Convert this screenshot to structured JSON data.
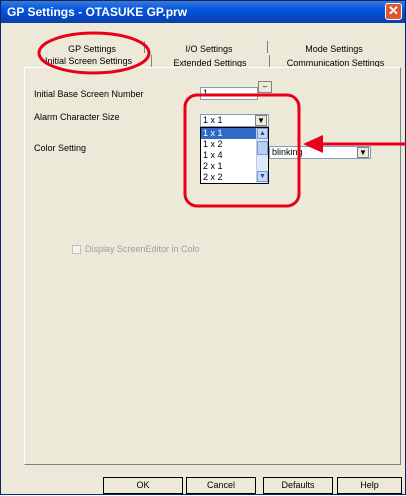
{
  "window": {
    "title": "GP Settings - OTASUKE GP.prw"
  },
  "tabs": {
    "row1": [
      "GP Settings",
      "I/O Settings",
      "Mode Settings"
    ],
    "row2": [
      "Initial Screen Settings",
      "Extended Settings",
      "Communication Settings"
    ]
  },
  "form": {
    "initial_base_label": "Initial Base Screen Number",
    "initial_base_value": "1",
    "alarm_label": "Alarm Character Size",
    "alarm_value": "1 x 1",
    "alarm_options": [
      "1 x 1",
      "1 x 2",
      "1 x 4",
      "2 x 1",
      "2 x 2"
    ],
    "color_label": "Color Setting",
    "color_value": "blinking",
    "display_check_label": "Display ScreenEditor in Color"
  },
  "buttons": {
    "ok": "OK",
    "cancel": "Cancel",
    "defaults": "Defaults",
    "help": "Help"
  },
  "colors": {
    "annotation_red": "#e8001b",
    "title_blue": "#0054e3",
    "selection_blue": "#316ac5"
  }
}
